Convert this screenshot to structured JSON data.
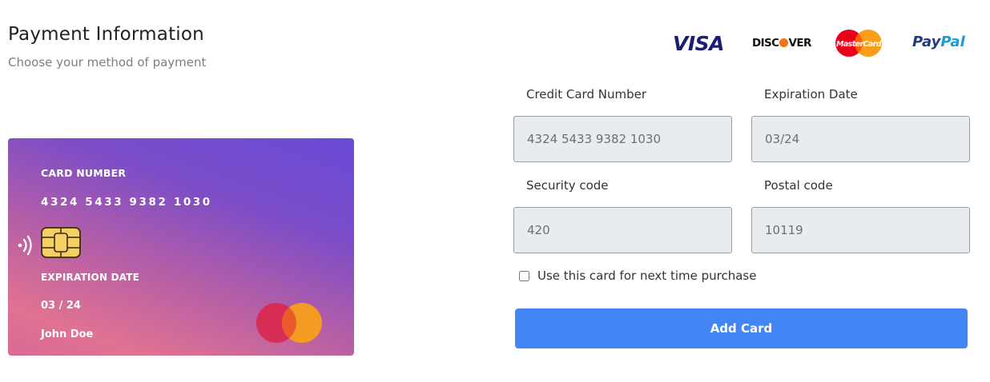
{
  "header": {
    "title": "Payment Information",
    "subtitle": "Choose your method of payment"
  },
  "card_preview": {
    "number_label": "CARD NUMBER",
    "number": "4324 5433 9382 1030",
    "expiration_label": "EXPIRATION DATE",
    "expiration": "03 / 24",
    "holder_name": "John Doe",
    "chip_icon": "card-chip-icon",
    "contactless_icon": "contactless-icon",
    "network_logo": "mastercard-logo"
  },
  "brands": {
    "visa": "VISA",
    "discover_pre": "DISC",
    "discover_post": "VER",
    "mastercard": "MasterCard",
    "paypal_1": "Pay",
    "paypal_2": "Pal"
  },
  "form": {
    "card_number_label": "Credit Card Number",
    "card_number_placeholder": "4324 5433 9382 1030",
    "expiration_label": "Expiration Date",
    "expiration_placeholder": "03/24",
    "security_label": "Security code",
    "security_placeholder": "420",
    "postal_label": "Postal code",
    "postal_placeholder": "10119",
    "save_card_label": "Use this card for next time purchase",
    "save_card_checked": false,
    "submit_label": "Add Card"
  },
  "colors": {
    "accent": "#4285f4",
    "card_gradient_top": "#6a4bd6",
    "card_gradient_bottom": "#e07292",
    "field_bg": "#e9ecee"
  }
}
